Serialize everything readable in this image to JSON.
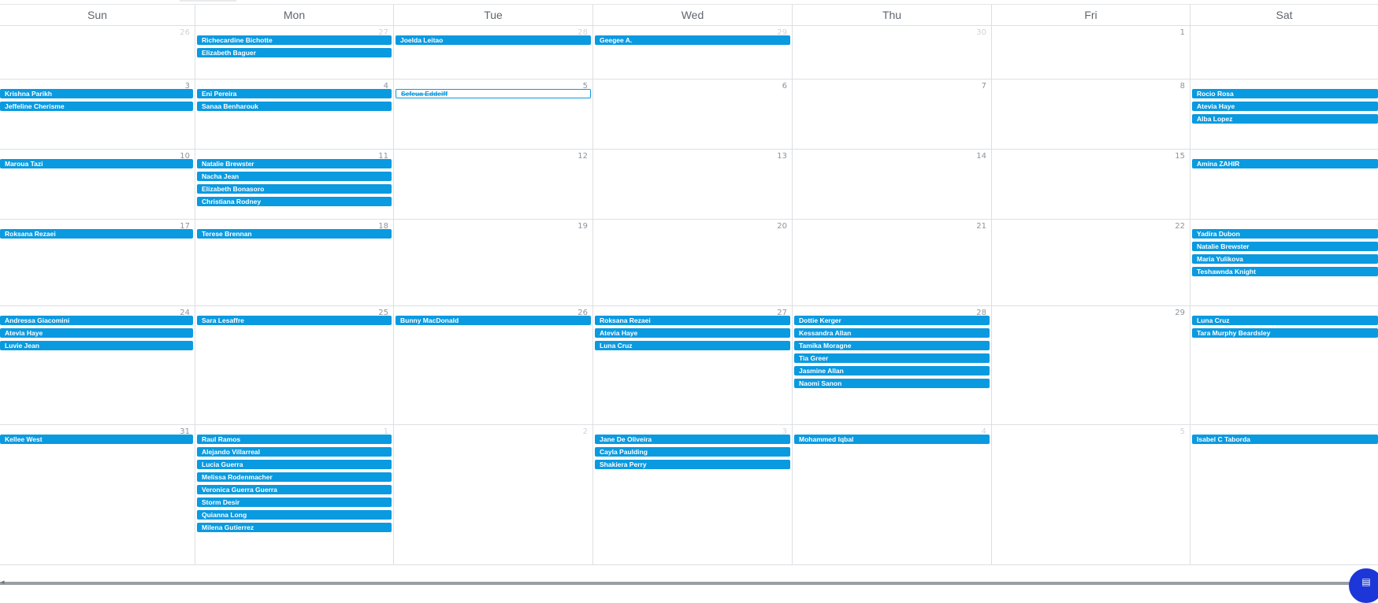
{
  "calendar": {
    "weekdays": [
      "Sun",
      "Mon",
      "Tue",
      "Wed",
      "Thu",
      "Fri",
      "Sat"
    ],
    "weeks": [
      {
        "days": [
          {
            "num": "26",
            "dim": true,
            "events": []
          },
          {
            "num": "27",
            "dim": true,
            "events": [
              {
                "name": "Richecardine Bichotte"
              },
              {
                "name": "Elizabeth Baguer"
              }
            ]
          },
          {
            "num": "28",
            "dim": true,
            "events": [
              {
                "name": "Joelda Leitao"
              }
            ]
          },
          {
            "num": "29",
            "dim": true,
            "events": [
              {
                "name": "Geegee A."
              }
            ]
          },
          {
            "num": "30",
            "dim": true,
            "events": []
          },
          {
            "num": "1",
            "dim": false,
            "events": []
          },
          {
            "num": "",
            "dim": false,
            "events": []
          }
        ]
      },
      {
        "days": [
          {
            "num": "3",
            "dim": false,
            "events": [
              {
                "name": "Krishna  Parikh"
              },
              {
                "name": "Jeffeline Cherisme"
              }
            ]
          },
          {
            "num": "4",
            "dim": false,
            "events": [
              {
                "name": "Eni Pereira"
              },
              {
                "name": "Sanaa Benharouk"
              }
            ]
          },
          {
            "num": "5",
            "dim": false,
            "events": [
              {
                "name": "Sefeua Eddeiff",
                "cancelled": true
              }
            ]
          },
          {
            "num": "6",
            "dim": false,
            "events": []
          },
          {
            "num": "7",
            "dim": false,
            "events": []
          },
          {
            "num": "8",
            "dim": false,
            "events": []
          },
          {
            "num": "",
            "dim": false,
            "events": [
              {
                "name": "Rocio Rosa"
              },
              {
                "name": "Atevia Haye"
              },
              {
                "name": "Alba Lopez"
              }
            ]
          }
        ]
      },
      {
        "days": [
          {
            "num": "10",
            "dim": false,
            "events": [
              {
                "name": "Maroua  Tazi"
              }
            ]
          },
          {
            "num": "11",
            "dim": false,
            "events": [
              {
                "name": "Natalie Brewster"
              },
              {
                "name": "Nacha  Jean"
              },
              {
                "name": "Elizabeth Bonasoro"
              },
              {
                "name": "Christiana Rodney"
              }
            ]
          },
          {
            "num": "12",
            "dim": false,
            "events": []
          },
          {
            "num": "13",
            "dim": false,
            "events": []
          },
          {
            "num": "14",
            "dim": false,
            "events": []
          },
          {
            "num": "15",
            "dim": false,
            "events": []
          },
          {
            "num": "",
            "dim": false,
            "events": [
              {
                "name": "Amina ZAHIR"
              }
            ]
          }
        ]
      },
      {
        "days": [
          {
            "num": "17",
            "dim": false,
            "events": [
              {
                "name": "Roksana  Rezaei"
              }
            ]
          },
          {
            "num": "18",
            "dim": false,
            "events": [
              {
                "name": "Terese Brennan"
              }
            ]
          },
          {
            "num": "19",
            "dim": false,
            "events": []
          },
          {
            "num": "20",
            "dim": false,
            "events": []
          },
          {
            "num": "21",
            "dim": false,
            "events": []
          },
          {
            "num": "22",
            "dim": false,
            "events": []
          },
          {
            "num": "",
            "dim": false,
            "events": [
              {
                "name": "Yadira Dubon"
              },
              {
                "name": "Natalie Brewster"
              },
              {
                "name": "Maria Yulikova"
              },
              {
                "name": "Teshawnda Knight"
              }
            ]
          }
        ]
      },
      {
        "days": [
          {
            "num": "24",
            "dim": false,
            "events": [
              {
                "name": "Andressa Giacomini"
              },
              {
                "name": "Atevia Haye"
              },
              {
                "name": "Luvie Jean"
              }
            ]
          },
          {
            "num": "25",
            "dim": false,
            "events": [
              {
                "name": "Sara Lesaffre"
              }
            ]
          },
          {
            "num": "26",
            "dim": false,
            "events": [
              {
                "name": "Bunny MacDonald"
              }
            ]
          },
          {
            "num": "27",
            "dim": false,
            "events": [
              {
                "name": "Roksana  Rezaei"
              },
              {
                "name": "Atevia Haye"
              },
              {
                "name": "Luna Cruz"
              }
            ]
          },
          {
            "num": "28",
            "dim": false,
            "events": [
              {
                "name": "Dottie Kerger"
              },
              {
                "name": "Kessandra Allan"
              },
              {
                "name": "Tamika Moragne"
              },
              {
                "name": "Tia Greer"
              },
              {
                "name": "Jasmine Allan"
              },
              {
                "name": "Naomi Sanon"
              }
            ]
          },
          {
            "num": "29",
            "dim": false,
            "events": []
          },
          {
            "num": "",
            "dim": false,
            "events": [
              {
                "name": "Luna Cruz"
              },
              {
                "name": "Tara Murphy Beardsley"
              }
            ]
          }
        ]
      },
      {
        "days": [
          {
            "num": "31",
            "dim": false,
            "events": [
              {
                "name": "Kellee West"
              }
            ]
          },
          {
            "num": "1",
            "dim": true,
            "events": [
              {
                "name": "Raul Ramos"
              },
              {
                "name": "Alejando Villarreal"
              },
              {
                "name": "Lucia Guerra"
              },
              {
                "name": "Melissa Rodenmacher"
              },
              {
                "name": "Veronica Guerra  Guerra"
              },
              {
                "name": "Storm Desir"
              },
              {
                "name": "Quianna Long"
              },
              {
                "name": "Milena Gutierrez"
              }
            ]
          },
          {
            "num": "2",
            "dim": true,
            "events": []
          },
          {
            "num": "3",
            "dim": true,
            "events": [
              {
                "name": "Jane De Oliveira"
              },
              {
                "name": "Cayla Paulding"
              },
              {
                "name": "Shakiera Perry"
              }
            ]
          },
          {
            "num": "4",
            "dim": true,
            "events": [
              {
                "name": "Mohammed Iqbal"
              }
            ]
          },
          {
            "num": "5",
            "dim": true,
            "events": []
          },
          {
            "num": "",
            "dim": false,
            "events": [
              {
                "name": "Isabel C Taborda"
              }
            ]
          }
        ]
      }
    ]
  },
  "fab": {
    "icon": "chat-icon",
    "glyph": "▤"
  },
  "scrollbar": {
    "arrow": "◂"
  },
  "colors": {
    "event": "#0a9ae0",
    "grid": "#dcdfe3",
    "fab": "#1d36d8"
  }
}
